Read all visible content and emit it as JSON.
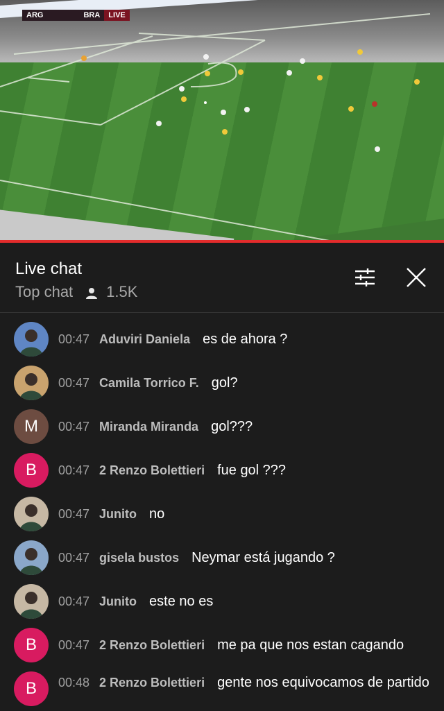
{
  "video": {
    "scorebug": {
      "home": "ARG",
      "away": "BRA",
      "status": "LIVE"
    }
  },
  "chat": {
    "title": "Live chat",
    "mode": "Top chat",
    "viewers": "1.5K",
    "messages": [
      {
        "time": "00:47",
        "author": "Aduviri Daniela",
        "text": "es de ahora ?",
        "avatar": {
          "type": "photo",
          "color": "#5f86c4"
        }
      },
      {
        "time": "00:47",
        "author": "Camila Torrico F.",
        "text": "gol?",
        "avatar": {
          "type": "photo",
          "color": "#c9a36e"
        }
      },
      {
        "time": "00:47",
        "author": "Miranda Miranda",
        "text": "gol???",
        "avatar": {
          "type": "letter",
          "letter": "M",
          "color": "#6d4c41"
        }
      },
      {
        "time": "00:47",
        "author": "2 Renzo Bolettieri",
        "text": "fue gol ???",
        "avatar": {
          "type": "letter",
          "letter": "B",
          "color": "#d81b60"
        }
      },
      {
        "time": "00:47",
        "author": "Junito",
        "text": "no",
        "avatar": {
          "type": "photo",
          "color": "#c6b8a4"
        }
      },
      {
        "time": "00:47",
        "author": "gisela bustos",
        "text": "Neymar está jugando ?",
        "avatar": {
          "type": "photo",
          "color": "#8aa7c9"
        }
      },
      {
        "time": "00:47",
        "author": "Junito",
        "text": "este no es",
        "avatar": {
          "type": "photo",
          "color": "#c6b8a4"
        }
      },
      {
        "time": "00:47",
        "author": "2 Renzo Bolettieri",
        "text": "me pa que nos estan cagando",
        "avatar": {
          "type": "letter",
          "letter": "B",
          "color": "#d81b60"
        }
      },
      {
        "time": "00:48",
        "author": "2 Renzo Bolettieri",
        "text": "gente nos equivocamos de partido",
        "avatar": {
          "type": "letter",
          "letter": "B",
          "color": "#d81b60"
        }
      }
    ]
  },
  "colors": {
    "accent": "#e32c2c",
    "background": "#1c1c1c"
  }
}
